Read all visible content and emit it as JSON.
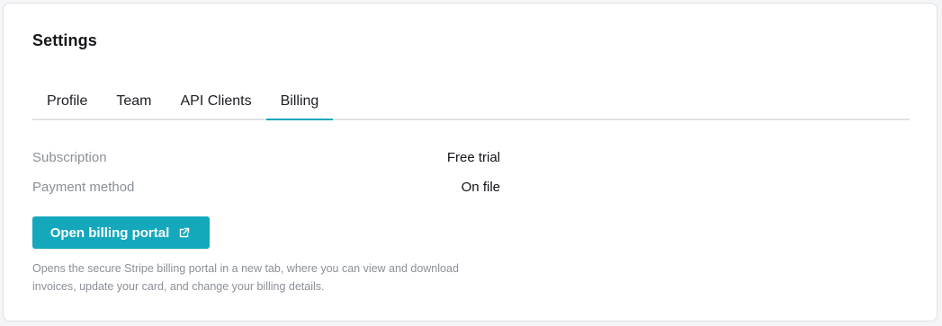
{
  "settings": {
    "title": "Settings",
    "tabs": [
      {
        "label": "Profile"
      },
      {
        "label": "Team"
      },
      {
        "label": "API Clients"
      },
      {
        "label": "Billing"
      }
    ],
    "active_tab": "Billing"
  },
  "billing": {
    "rows": [
      {
        "label": "Subscription",
        "value": "Free trial"
      },
      {
        "label": "Payment method",
        "value": "On file"
      }
    ],
    "portal_button_label": "Open billing portal",
    "portal_button_icon": "external-link-icon",
    "help_text": "Opens the secure Stripe billing portal in a new tab, where you can view and download invoices, update your card, and change your billing details."
  },
  "colors": {
    "accent": "#14a8bd",
    "muted_text": "#8b9098",
    "border": "#dfe2e6"
  }
}
